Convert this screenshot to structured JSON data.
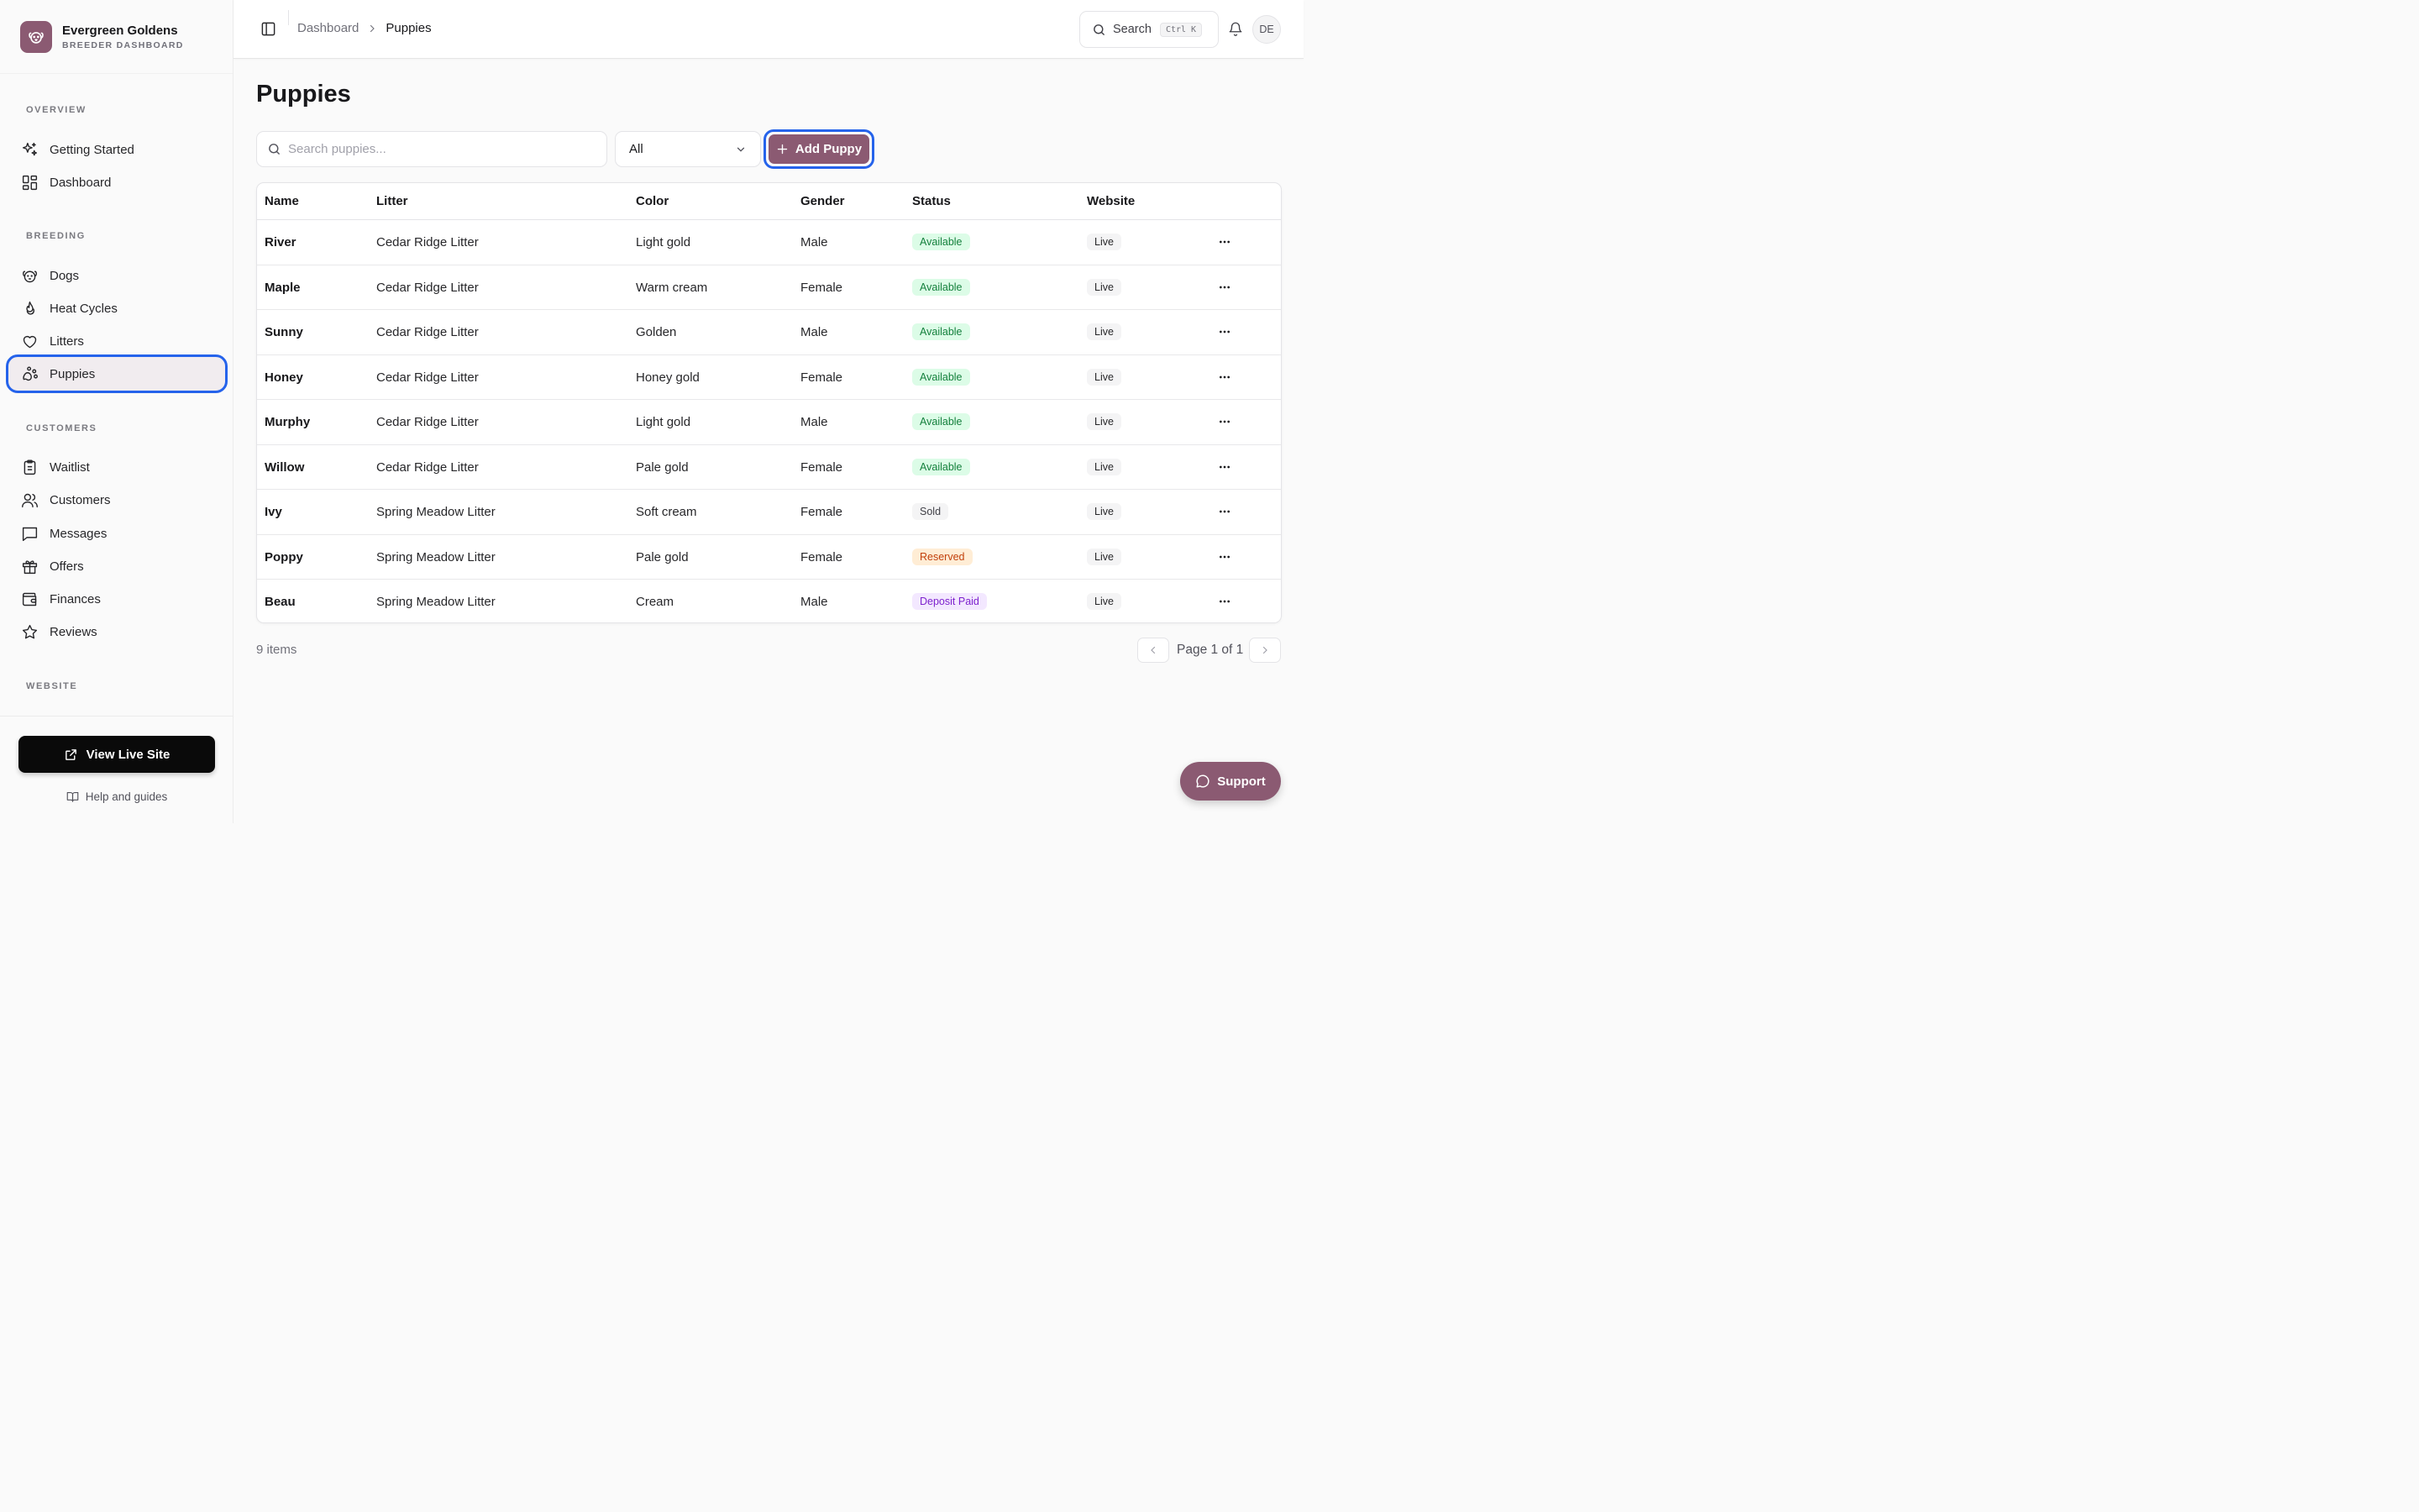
{
  "brand": {
    "name": "Evergreen Goldens",
    "subtitle": "BREEDER DASHBOARD"
  },
  "sidebar": {
    "sections": [
      {
        "label": "OVERVIEW"
      },
      {
        "label": "BREEDING"
      },
      {
        "label": "CUSTOMERS"
      },
      {
        "label": "WEBSITE"
      }
    ],
    "items": [
      {
        "label": "Getting Started",
        "icon": "sparkles-icon"
      },
      {
        "label": "Dashboard",
        "icon": "grid-icon"
      },
      {
        "label": "Dogs",
        "icon": "dog-icon"
      },
      {
        "label": "Heat Cycles",
        "icon": "flame-icon"
      },
      {
        "label": "Litters",
        "icon": "heart-icon"
      },
      {
        "label": "Puppies",
        "icon": "paw-icon",
        "active": true
      },
      {
        "label": "Waitlist",
        "icon": "clipboard-icon"
      },
      {
        "label": "Customers",
        "icon": "users-icon"
      },
      {
        "label": "Messages",
        "icon": "message-icon"
      },
      {
        "label": "Offers",
        "icon": "gift-icon"
      },
      {
        "label": "Finances",
        "icon": "wallet-icon"
      },
      {
        "label": "Reviews",
        "icon": "star-icon"
      }
    ],
    "view_live_site": "View Live Site",
    "help": "Help and guides"
  },
  "topbar": {
    "breadcrumb": [
      "Dashboard",
      "Puppies"
    ],
    "search_label": "Search",
    "search_kbd": "Ctrl K",
    "avatar_initials": "DE"
  },
  "main": {
    "title": "Puppies",
    "search_placeholder": "Search puppies...",
    "filter_value": "All",
    "add_label": "Add Puppy",
    "columns": [
      "Name",
      "Litter",
      "Color",
      "Gender",
      "Status",
      "Website"
    ],
    "rows": [
      {
        "name": "River",
        "litter": "Cedar Ridge Litter",
        "color": "Light gold",
        "gender": "Male",
        "status": "Available",
        "website": "Live"
      },
      {
        "name": "Maple",
        "litter": "Cedar Ridge Litter",
        "color": "Warm cream",
        "gender": "Female",
        "status": "Available",
        "website": "Live"
      },
      {
        "name": "Sunny",
        "litter": "Cedar Ridge Litter",
        "color": "Golden",
        "gender": "Male",
        "status": "Available",
        "website": "Live"
      },
      {
        "name": "Honey",
        "litter": "Cedar Ridge Litter",
        "color": "Honey gold",
        "gender": "Female",
        "status": "Available",
        "website": "Live"
      },
      {
        "name": "Murphy",
        "litter": "Cedar Ridge Litter",
        "color": "Light gold",
        "gender": "Male",
        "status": "Available",
        "website": "Live"
      },
      {
        "name": "Willow",
        "litter": "Cedar Ridge Litter",
        "color": "Pale gold",
        "gender": "Female",
        "status": "Available",
        "website": "Live"
      },
      {
        "name": "Ivy",
        "litter": "Spring Meadow Litter",
        "color": "Soft cream",
        "gender": "Female",
        "status": "Sold",
        "website": "Live"
      },
      {
        "name": "Poppy",
        "litter": "Spring Meadow Litter",
        "color": "Pale gold",
        "gender": "Female",
        "status": "Reserved",
        "website": "Live"
      },
      {
        "name": "Beau",
        "litter": "Spring Meadow Litter",
        "color": "Cream",
        "gender": "Male",
        "status": "Deposit Paid",
        "website": "Live"
      }
    ],
    "items_count": "9 items",
    "page_text": "Page 1 of 1"
  },
  "support_label": "Support",
  "colors": {
    "brand": "#8b5a72",
    "focus": "#2563eb"
  }
}
